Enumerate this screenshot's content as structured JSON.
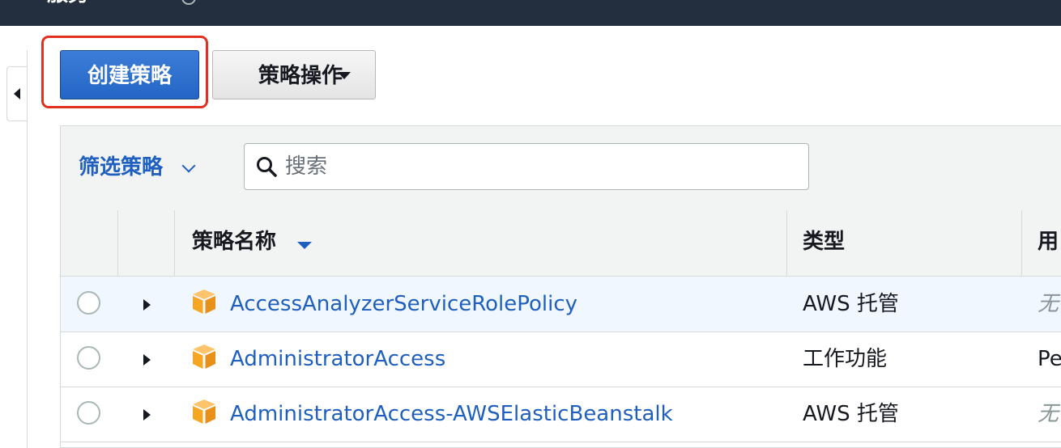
{
  "topbar": {
    "nav_text": "服务"
  },
  "toolbar": {
    "create_policy_label": "创建策略",
    "policy_actions_label": "策略操作"
  },
  "filter": {
    "label": "筛选策略",
    "search_placeholder": "搜索"
  },
  "table": {
    "columns": {
      "name": "策略名称",
      "type": "类型",
      "used_as": "用"
    },
    "rows": [
      {
        "name": "AccessAnalyzerServiceRolePolicy",
        "type": "AWS 托管",
        "used_as": "无"
      },
      {
        "name": "AdministratorAccess",
        "type": "工作功能",
        "used_as": "Pe"
      },
      {
        "name": "AdministratorAccess-AWSElasticBeanstalk",
        "type": "AWS 托管",
        "used_as": "无"
      }
    ]
  },
  "colors": {
    "topbar": "#232f3e",
    "primary": "#2466c4",
    "link": "#1f5fbf",
    "highlight": "#e0301e",
    "policy_icon": "#f5a623",
    "selected_row": "#f1f7fe"
  }
}
